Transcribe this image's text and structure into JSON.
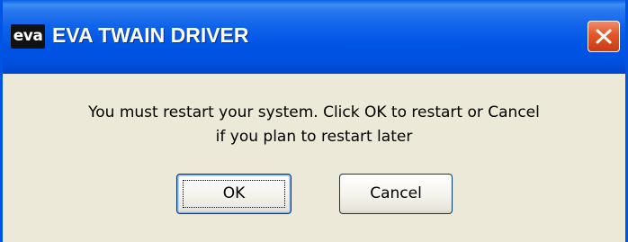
{
  "window": {
    "title": "EVA TWAIN DRIVER",
    "logo_text": "eva",
    "close_icon": "close-icon"
  },
  "dialog": {
    "message_line1": "You must restart your system. Click OK to restart or Cancel",
    "message_line2": "if you plan to restart later",
    "ok_label": "OK",
    "cancel_label": "Cancel"
  },
  "colors": {
    "titlebar": "#0055e5",
    "background": "#ece9d8",
    "close_button": "#e2572a"
  }
}
